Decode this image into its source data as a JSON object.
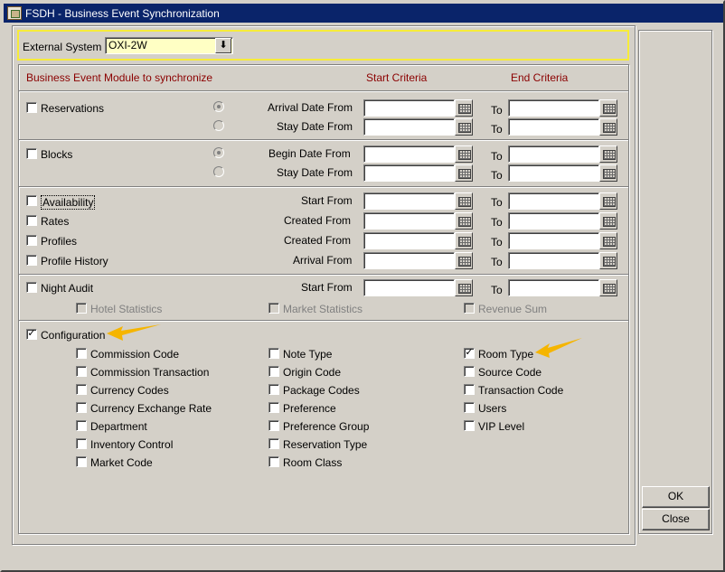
{
  "window": {
    "title": "FSDH - Business Event Synchronization"
  },
  "external_system": {
    "label": "External System",
    "value": "OXI-2W"
  },
  "headers": {
    "module": "Business Event Module to synchronize",
    "start": "Start Criteria",
    "end": "End Criteria"
  },
  "to_label": "To",
  "reservations": {
    "label": "Reservations",
    "checked": false,
    "options": [
      {
        "label": "Arrival Date From",
        "selected": true
      },
      {
        "label": "Stay Date From",
        "selected": false
      }
    ]
  },
  "blocks": {
    "label": "Blocks",
    "checked": false,
    "options": [
      {
        "label": "Begin Date From",
        "selected": true
      },
      {
        "label": "Stay Date From",
        "selected": false
      }
    ]
  },
  "modules": [
    {
      "label": "Availability",
      "criteria": "Start From",
      "checked": false
    },
    {
      "label": "Rates",
      "criteria": "Created From",
      "checked": false
    },
    {
      "label": "Profiles",
      "criteria": "Created From",
      "checked": false
    },
    {
      "label": "Profile History",
      "criteria": "Arrival From",
      "checked": false
    }
  ],
  "night_audit": {
    "label": "Night Audit",
    "criteria": "Start From",
    "checked": false,
    "sub": [
      {
        "label": "Hotel Statistics",
        "enabled": false
      },
      {
        "label": "Market Statistics",
        "enabled": false
      },
      {
        "label": "Revenue Sum",
        "enabled": false
      }
    ]
  },
  "configuration": {
    "label": "Configuration",
    "checked": true,
    "col1": [
      {
        "label": "Commission Code",
        "checked": false
      },
      {
        "label": "Commission Transaction",
        "checked": false
      },
      {
        "label": "Currency Codes",
        "checked": false
      },
      {
        "label": "Currency Exchange Rate",
        "checked": false
      },
      {
        "label": "Department",
        "checked": false
      },
      {
        "label": "Inventory Control",
        "checked": false
      },
      {
        "label": "Market Code",
        "checked": false
      }
    ],
    "col2": [
      {
        "label": "Note Type",
        "checked": false
      },
      {
        "label": "Origin Code",
        "checked": false
      },
      {
        "label": "Package Codes",
        "checked": false
      },
      {
        "label": "Preference",
        "checked": false
      },
      {
        "label": "Preference Group",
        "checked": false
      },
      {
        "label": "Reservation Type",
        "checked": false
      },
      {
        "label": "Room Class",
        "checked": false
      }
    ],
    "col3": [
      {
        "label": "Room Type",
        "checked": true
      },
      {
        "label": "Source Code",
        "checked": false
      },
      {
        "label": "Transaction Code",
        "checked": false
      },
      {
        "label": "Users",
        "checked": false
      },
      {
        "label": "VIP Level",
        "checked": false
      }
    ]
  },
  "buttons": {
    "ok": "OK",
    "close": "Close"
  },
  "colors": {
    "title_bar": "#0a246a",
    "header_text": "#8b0000",
    "highlight_box": "#f7ec39",
    "arrow": "#f5b500",
    "combo_bg": "#ffffc4"
  }
}
